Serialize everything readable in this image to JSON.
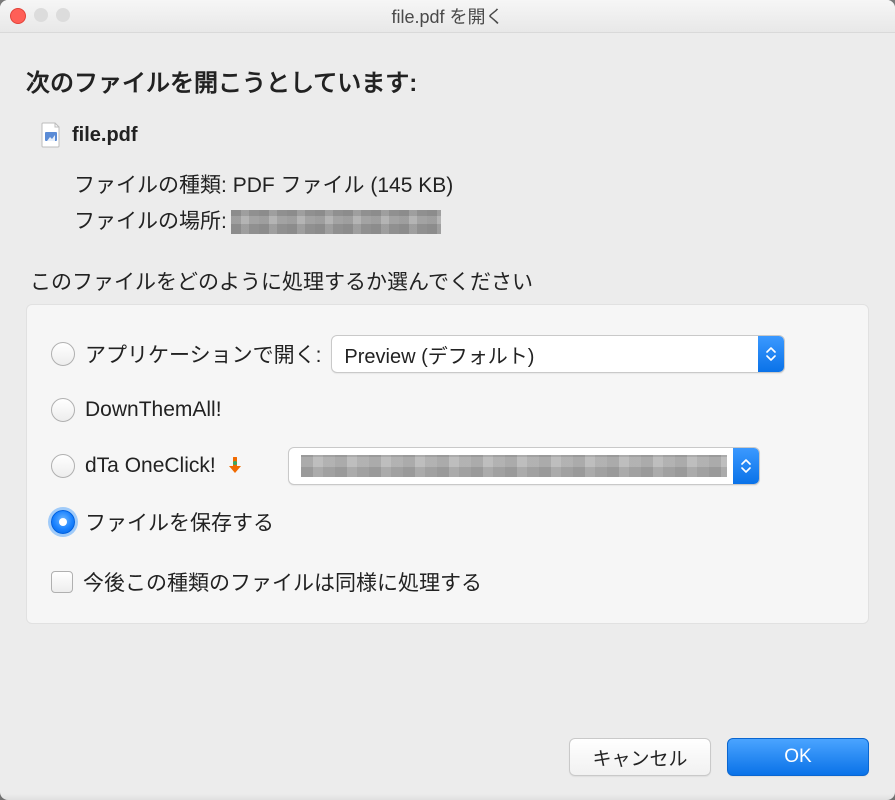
{
  "window": {
    "title": "file.pdf を開く"
  },
  "heading": "次のファイルを開こうとしています:",
  "file": {
    "name": "file.pdf",
    "type_label": "ファイルの種類:",
    "type_value": "PDF ファイル (145 KB)",
    "location_label": "ファイルの場所:"
  },
  "prompt": "このファイルをどのように処理するか選んでください",
  "options": {
    "open_with_label": "アプリケーションで開く:",
    "open_with_value": "Preview (デフォルト)",
    "dta_label": "DownThemAll!",
    "dta_one_label": "dTa OneClick!",
    "save_label": "ファイルを保存する"
  },
  "remember_label": "今後この種類のファイルは同様に処理する",
  "buttons": {
    "cancel": "キャンセル",
    "ok": "OK"
  }
}
